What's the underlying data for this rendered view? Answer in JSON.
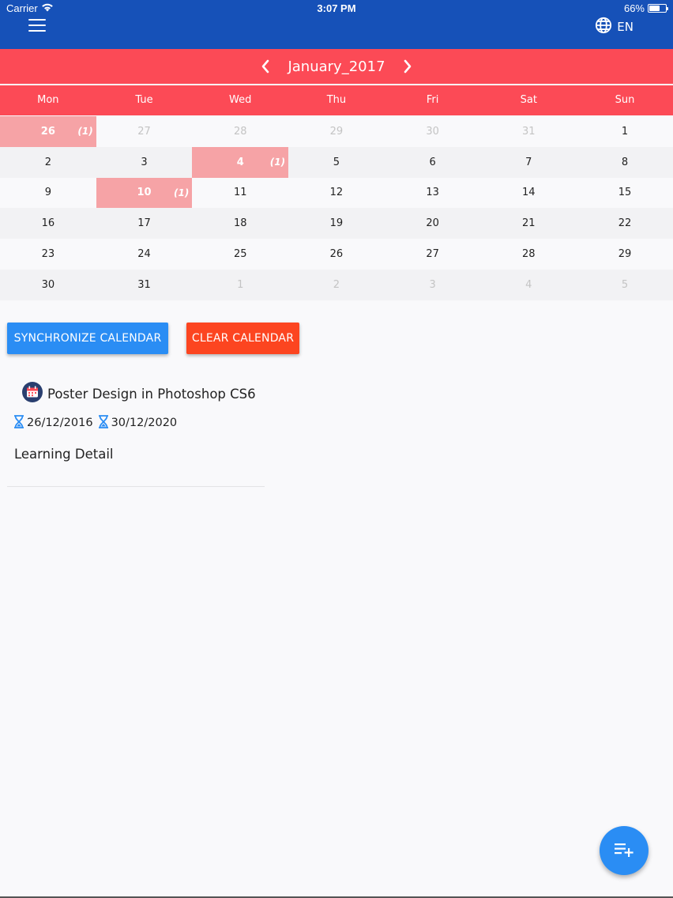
{
  "status_bar": {
    "carrier": "Carrier",
    "time": "3:07 PM",
    "battery": "66%",
    "battery_level": 0.66
  },
  "header": {
    "language": "EN"
  },
  "calendar": {
    "month_title": "January_2017",
    "weekdays": [
      "Mon",
      "Tue",
      "Wed",
      "Thu",
      "Fri",
      "Sat",
      "Sun"
    ],
    "weeks": [
      [
        {
          "day": "26",
          "muted": false,
          "event": true,
          "count": "(1)"
        },
        {
          "day": "27",
          "muted": true
        },
        {
          "day": "28",
          "muted": true
        },
        {
          "day": "29",
          "muted": true
        },
        {
          "day": "30",
          "muted": true
        },
        {
          "day": "31",
          "muted": true
        },
        {
          "day": "1"
        }
      ],
      [
        {
          "day": "2"
        },
        {
          "day": "3"
        },
        {
          "day": "4",
          "event": true,
          "count": "(1)"
        },
        {
          "day": "5"
        },
        {
          "day": "6"
        },
        {
          "day": "7"
        },
        {
          "day": "8"
        }
      ],
      [
        {
          "day": "9"
        },
        {
          "day": "10",
          "event": true,
          "count": "(1)"
        },
        {
          "day": "11"
        },
        {
          "day": "12"
        },
        {
          "day": "13"
        },
        {
          "day": "14"
        },
        {
          "day": "15"
        }
      ],
      [
        {
          "day": "16"
        },
        {
          "day": "17"
        },
        {
          "day": "18"
        },
        {
          "day": "19"
        },
        {
          "day": "20"
        },
        {
          "day": "21"
        },
        {
          "day": "22"
        }
      ],
      [
        {
          "day": "23"
        },
        {
          "day": "24"
        },
        {
          "day": "25"
        },
        {
          "day": "26"
        },
        {
          "day": "27"
        },
        {
          "day": "28"
        },
        {
          "day": "29"
        }
      ],
      [
        {
          "day": "30"
        },
        {
          "day": "31"
        },
        {
          "day": "1",
          "muted": true
        },
        {
          "day": "2",
          "muted": true
        },
        {
          "day": "3",
          "muted": true
        },
        {
          "day": "4",
          "muted": true
        },
        {
          "day": "5",
          "muted": true
        }
      ]
    ]
  },
  "actions": {
    "sync_label": "SYNCHRONIZE CALENDAR",
    "clear_label": "CLEAR CALENDAR"
  },
  "event": {
    "title": "Poster Design in Photoshop CS6",
    "start_date": "26/12/2016",
    "end_date": "30/12/2020",
    "description": "Learning Detail"
  },
  "colors": {
    "primary": "#1651b8",
    "accent": "#fc4a56",
    "event_cell": "#f6a3a6",
    "sync": "#2a8df4",
    "clear": "#fc4520"
  },
  "icons": [
    "menu-icon",
    "globe-icon",
    "chevron-left-icon",
    "chevron-right-icon",
    "calendar-icon",
    "hourglass-icon",
    "playlist-add-icon",
    "wifi-icon"
  ]
}
